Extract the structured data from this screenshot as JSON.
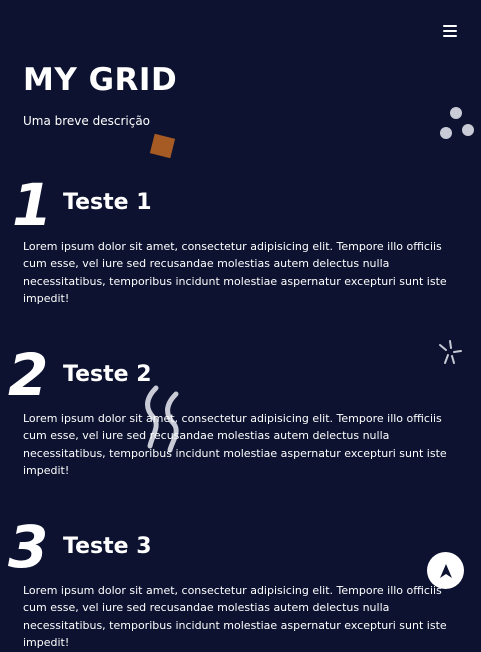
{
  "header": {
    "title": "MY GRID",
    "subtitle": "Uma breve descrição",
    "menu_icon": "hamburger-menu-icon"
  },
  "items": [
    {
      "number": "1",
      "title": "Teste 1",
      "text": "Lorem ipsum dolor sit amet, consectetur adipisicing elit. Tempore illo officiis cum esse, vel iure sed recusandae molestias autem delectus nulla necessitatibus, temporibus incidunt molestiae aspernatur excepturi sunt iste impedit!"
    },
    {
      "number": "2",
      "title": "Teste 2",
      "text": "Lorem ipsum dolor sit amet, consectetur adipisicing elit. Tempore illo officiis cum esse, vel iure sed recusandae molestias autem delectus nulla necessitatibus, temporibus incidunt molestiae aspernatur excepturi sunt iste impedit!"
    },
    {
      "number": "3",
      "title": "Teste 3",
      "text": "Lorem ipsum dolor sit amet, consectetur adipisicing elit. Tempore illo officiis cum esse, vel iure sed recusandae molestias autem delectus nulla necessitatibus, temporibus incidunt molestiae aspernatur excepturi sunt iste impedit!"
    }
  ],
  "scroll_button": {
    "icon": "navigation-arrow-icon"
  },
  "colors": {
    "background": "#0c1230",
    "text": "#ffffff",
    "accent_square": "#a65a24",
    "decoration": "#c9ccd6"
  }
}
